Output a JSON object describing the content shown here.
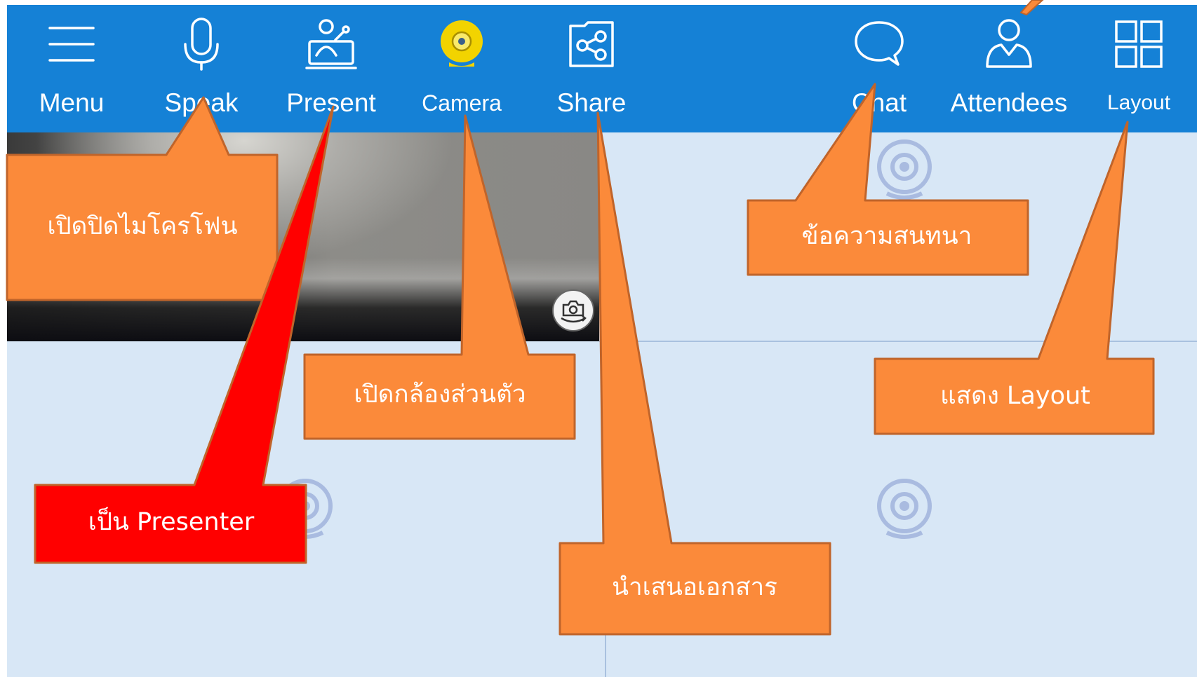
{
  "toolbar": {
    "items": [
      {
        "label": "Menu",
        "icon": "menu-icon"
      },
      {
        "label": "Speak",
        "icon": "microphone-icon"
      },
      {
        "label": "Present",
        "icon": "presenter-icon"
      },
      {
        "label": "Camera",
        "icon": "webcam-icon"
      },
      {
        "label": "Share",
        "icon": "share-icon"
      },
      {
        "label": "Chat",
        "icon": "chat-bubble-icon"
      },
      {
        "label": "Attendees",
        "icon": "attendee-icon"
      },
      {
        "label": "Layout",
        "icon": "grid-layout-icon"
      }
    ]
  },
  "video": {
    "switch_camera_icon": "camera-switch-icon",
    "placeholder_icon": "webcam-placeholder-icon"
  },
  "callouts": {
    "speak": "เปิดปิดไมโครโฟน",
    "present": "เป็น Presenter",
    "camera": "เปิดกล้องส่วนตัว",
    "share": "นำเสนอเอกสาร",
    "chat": "ข้อความสนทนา",
    "layout": "แสดง Layout"
  },
  "colors": {
    "toolbar_bg": "#1581d6",
    "stage_bg": "#d8e7f6",
    "camera_active": "#f2d300",
    "callout_orange": "#fb8a3a",
    "callout_red": "#ff0000",
    "callout_border": "#c0642a"
  }
}
